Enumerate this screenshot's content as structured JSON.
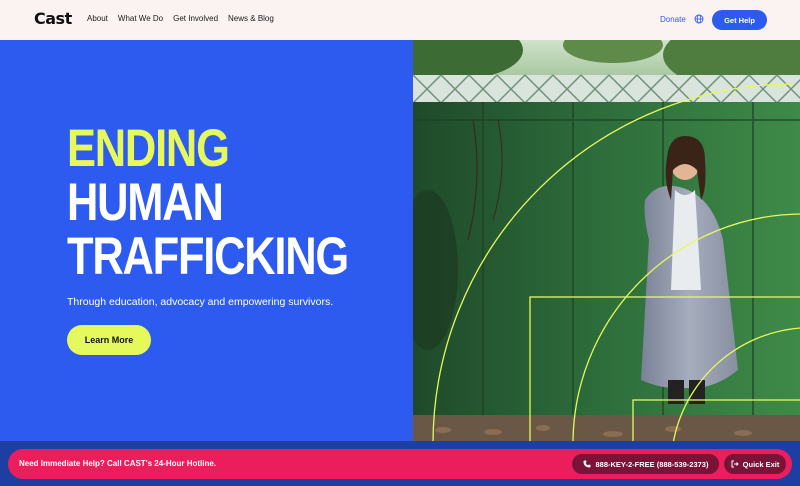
{
  "header": {
    "logo": "Cast",
    "nav": [
      "About",
      "What We Do",
      "Get Involved",
      "News & Blog"
    ],
    "donate": "Donate",
    "globe_icon": "globe-icon",
    "get_help": "Get Help"
  },
  "hero": {
    "headline_line1": "ENDING",
    "headline_line2": "HUMAN",
    "headline_line3": "TRAFFICKING",
    "subtitle": "Through education, advocacy and empowering survivors.",
    "learn_more": "Learn More"
  },
  "banner": {
    "text": "Need Immediate Help? Call CAST's 24-Hour Hotline.",
    "hotline": "888-KEY-2-FREE (888-539-2373)",
    "phone_icon": "phone-icon",
    "quick_exit": "Quick Exit",
    "exit_icon": "exit-icon"
  },
  "colors": {
    "brand_blue": "#2d5bf0",
    "accent_yellow": "#e6f95c",
    "alert_pink": "#ea1e5c",
    "header_bg": "#fbf2f2"
  }
}
